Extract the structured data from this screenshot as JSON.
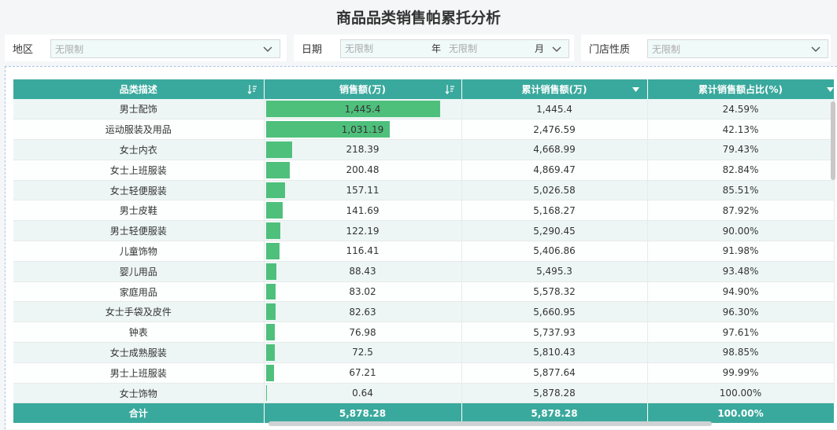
{
  "title": "商品品类销售帕累托分析",
  "filters": {
    "region": {
      "label": "地区",
      "placeholder": "无限制"
    },
    "date": {
      "label": "日期",
      "year_placeholder": "无限制",
      "year_unit": "年",
      "month_placeholder": "无限制",
      "month_unit": "月"
    },
    "store_type": {
      "label": "门店性质",
      "placeholder": "无限制"
    }
  },
  "table": {
    "headers": [
      "品类描述",
      "销售额(万)",
      "累计销售额(万)",
      "累计销售额占比(%)"
    ],
    "rows": [
      {
        "category": "男士配饰",
        "sales": "1,445.4",
        "sales_value": 1445.4,
        "cumulative": "1,445.4",
        "cumulative_pct": "24.59%"
      },
      {
        "category": "运动服装及用品",
        "sales": "1,031.19",
        "sales_value": 1031.19,
        "cumulative": "2,476.59",
        "cumulative_pct": "42.13%"
      },
      {
        "category": "女士内衣",
        "sales": "218.39",
        "sales_value": 218.39,
        "cumulative": "4,668.99",
        "cumulative_pct": "79.43%"
      },
      {
        "category": "女士上班服装",
        "sales": "200.48",
        "sales_value": 200.48,
        "cumulative": "4,869.47",
        "cumulative_pct": "82.84%"
      },
      {
        "category": "女士轻便服装",
        "sales": "157.11",
        "sales_value": 157.11,
        "cumulative": "5,026.58",
        "cumulative_pct": "85.51%"
      },
      {
        "category": "男士皮鞋",
        "sales": "141.69",
        "sales_value": 141.69,
        "cumulative": "5,168.27",
        "cumulative_pct": "87.92%"
      },
      {
        "category": "男士轻便服装",
        "sales": "122.19",
        "sales_value": 122.19,
        "cumulative": "5,290.45",
        "cumulative_pct": "90.00%"
      },
      {
        "category": "儿童饰物",
        "sales": "116.41",
        "sales_value": 116.41,
        "cumulative": "5,406.86",
        "cumulative_pct": "91.98%"
      },
      {
        "category": "婴儿用品",
        "sales": "88.43",
        "sales_value": 88.43,
        "cumulative": "5,495.3",
        "cumulative_pct": "93.48%"
      },
      {
        "category": "家庭用品",
        "sales": "83.02",
        "sales_value": 83.02,
        "cumulative": "5,578.32",
        "cumulative_pct": "94.90%"
      },
      {
        "category": "女士手袋及皮件",
        "sales": "82.63",
        "sales_value": 82.63,
        "cumulative": "5,660.95",
        "cumulative_pct": "96.30%"
      },
      {
        "category": "钟表",
        "sales": "76.98",
        "sales_value": 76.98,
        "cumulative": "5,737.93",
        "cumulative_pct": "97.61%"
      },
      {
        "category": "女士成熟服装",
        "sales": "72.5",
        "sales_value": 72.5,
        "cumulative": "5,810.43",
        "cumulative_pct": "98.85%"
      },
      {
        "category": "男士上班服装",
        "sales": "67.21",
        "sales_value": 67.21,
        "cumulative": "5,877.64",
        "cumulative_pct": "99.99%"
      },
      {
        "category": "女士饰物",
        "sales": "0.64",
        "sales_value": 0.64,
        "cumulative": "5,878.28",
        "cumulative_pct": "100.00%"
      }
    ],
    "total": {
      "label": "合计",
      "sales": "5,878.28",
      "cumulative": "5,878.28",
      "cumulative_pct": "100.00%"
    },
    "bar_max": 1445.4
  },
  "colors": {
    "header": "#3aa99d",
    "bar": "#4ec07c",
    "row_alt": "#eef6f5"
  },
  "icons": {
    "sort": "sort-desc-icon",
    "filter": "triangle-down-icon",
    "dropdown": "chevron-down-icon"
  }
}
